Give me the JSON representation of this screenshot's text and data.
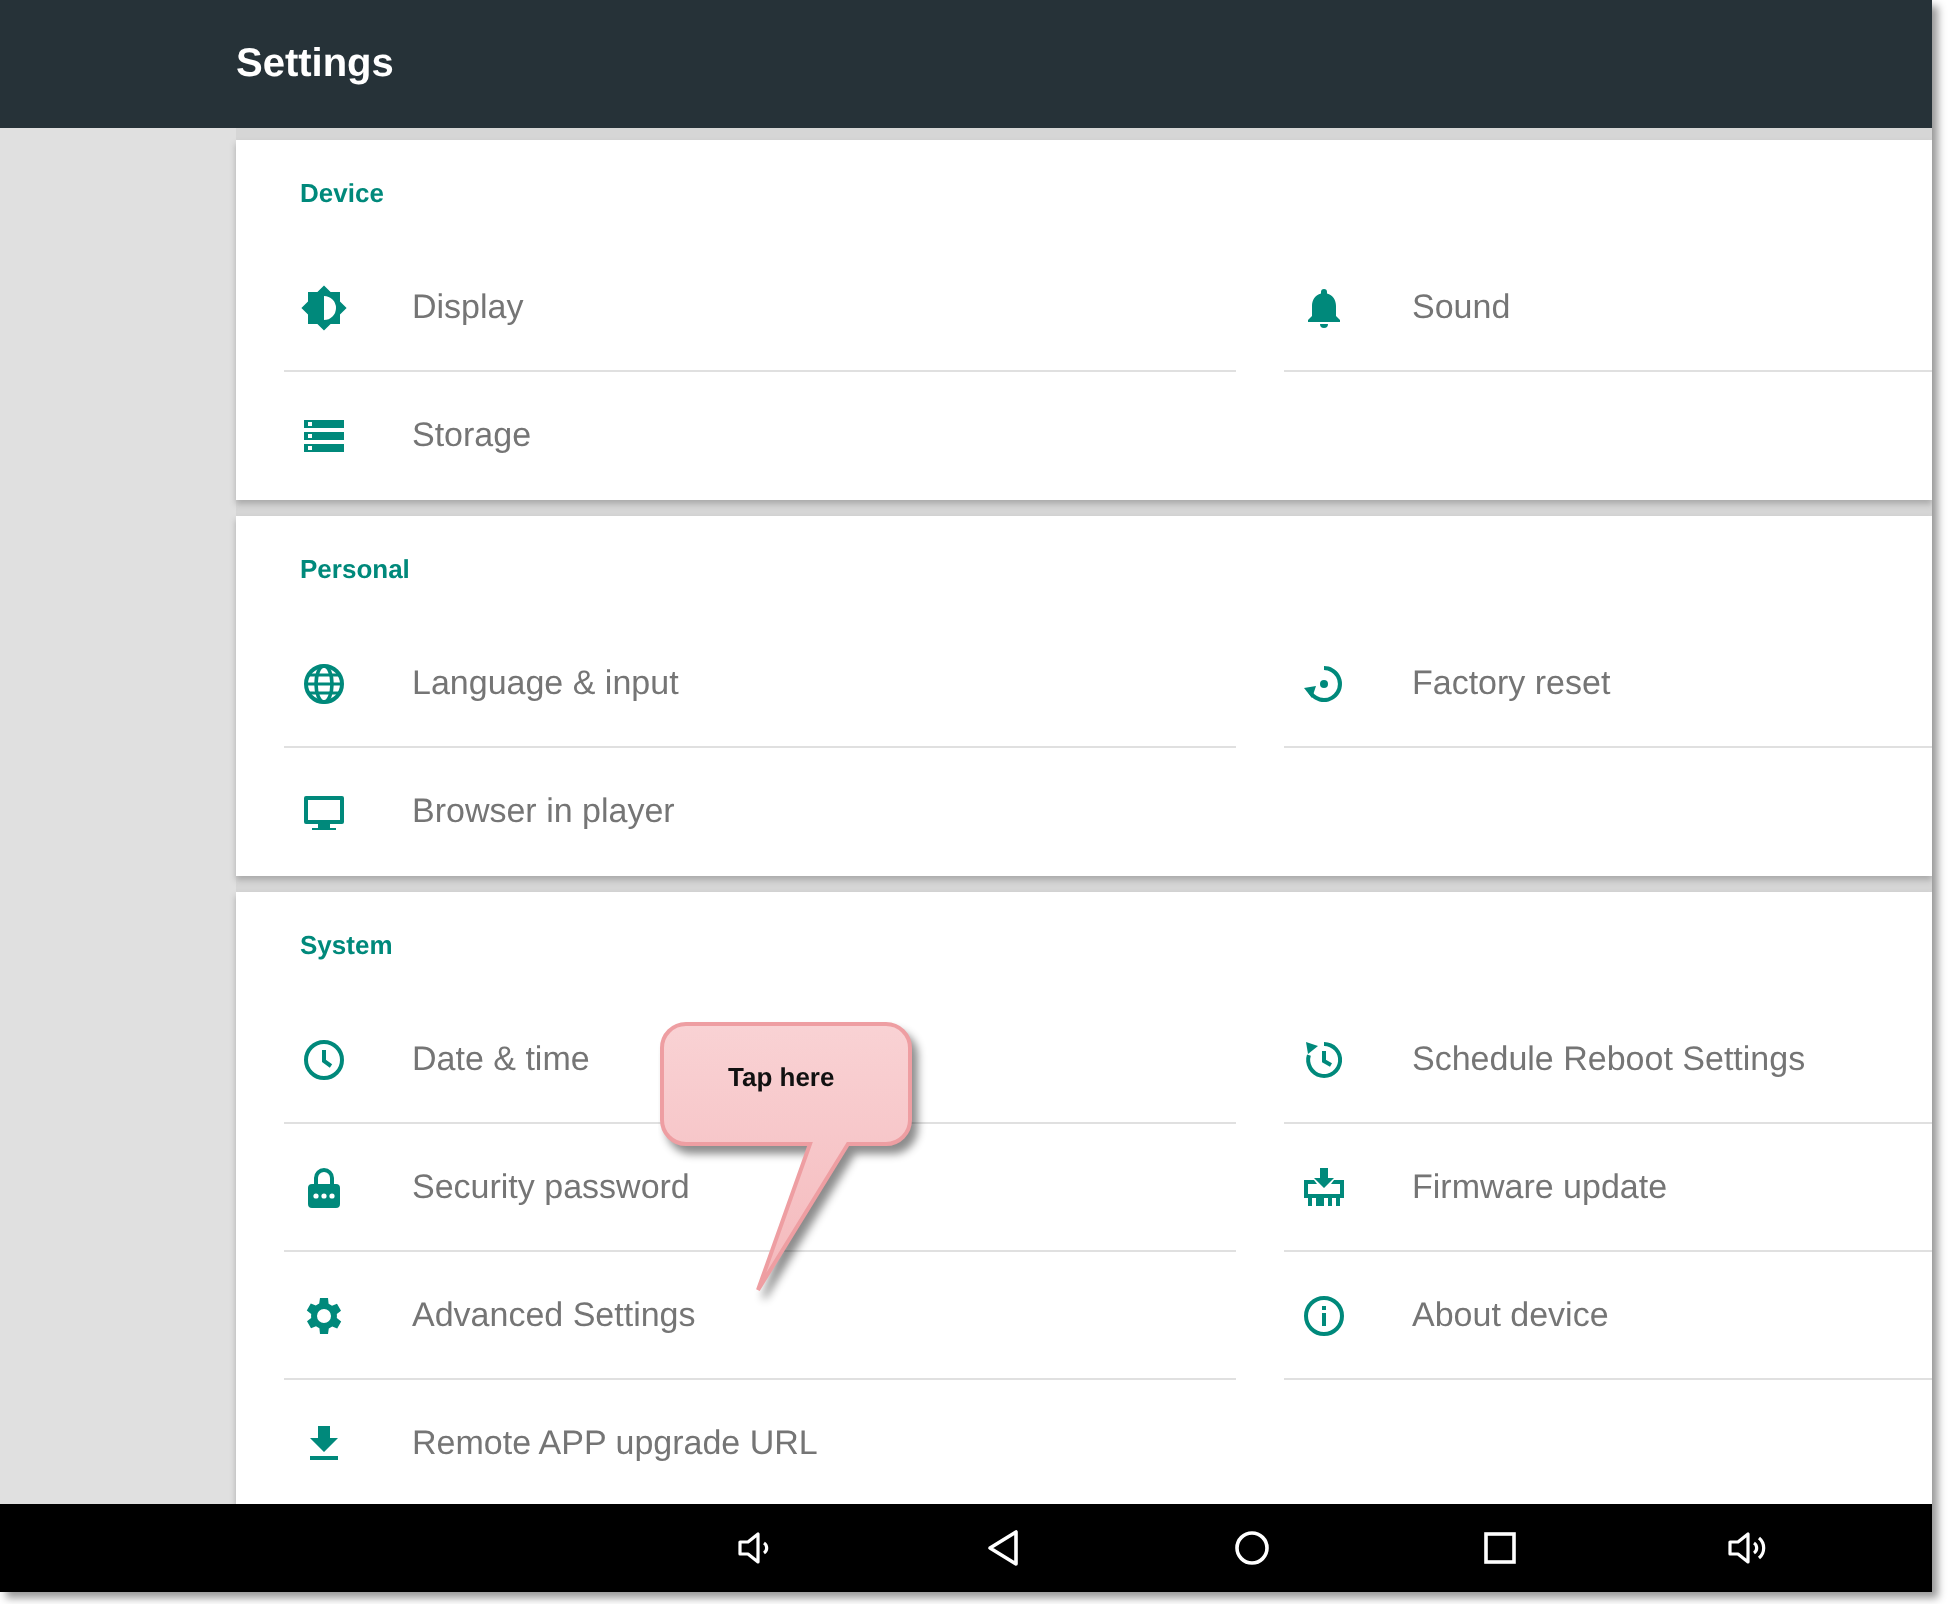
{
  "app_bar": {
    "title": "Settings"
  },
  "sections": [
    {
      "title": "Device",
      "rows": [
        [
          {
            "label": "Display"
          },
          {
            "label": "Sound"
          }
        ],
        [
          {
            "label": "Storage"
          }
        ]
      ]
    },
    {
      "title": "Personal",
      "rows": [
        [
          {
            "label": "Language & input"
          },
          {
            "label": "Factory reset"
          }
        ],
        [
          {
            "label": "Browser in player"
          }
        ]
      ]
    },
    {
      "title": "System",
      "rows": [
        [
          {
            "label": "Date & time"
          },
          {
            "label": "Schedule Reboot Settings"
          }
        ],
        [
          {
            "label": "Security password"
          },
          {
            "label": "Firmware update"
          }
        ],
        [
          {
            "label": "Advanced Settings"
          },
          {
            "label": "About device"
          }
        ],
        [
          {
            "label": "Remote APP upgrade URL"
          }
        ]
      ]
    }
  ],
  "callout": {
    "text": "Tap here"
  }
}
